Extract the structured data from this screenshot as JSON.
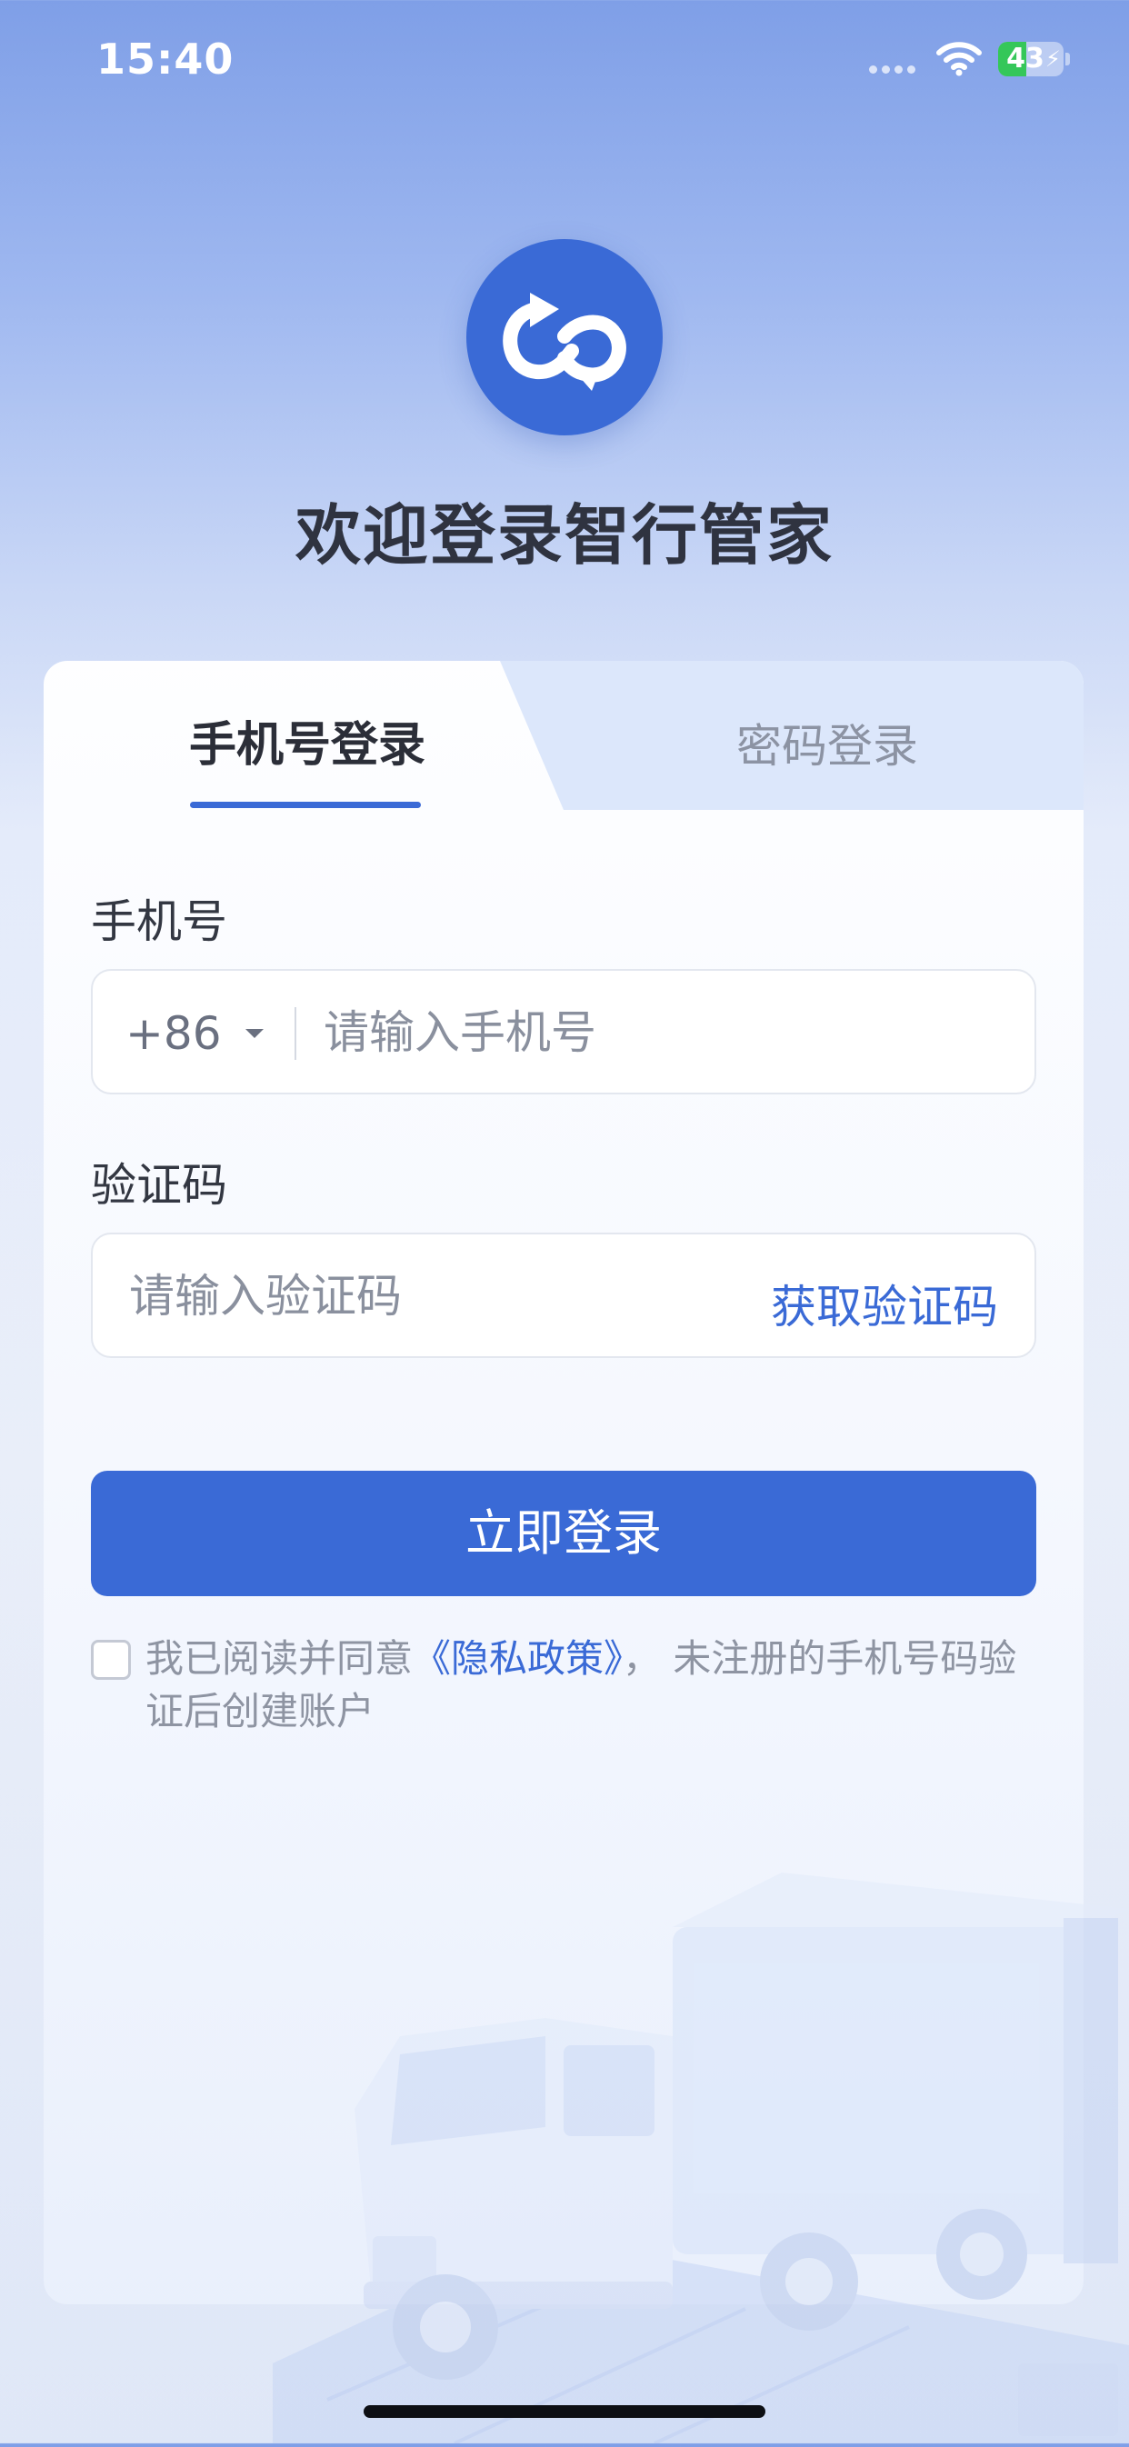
{
  "status_bar": {
    "time": "15:40",
    "battery_level": "43",
    "battery_fraction": 0.43,
    "wifi_icon": "wifi-icon",
    "battery_icon": "battery-charging-icon"
  },
  "header": {
    "logo_icon": "app-logo-infinity-arrow-icon",
    "welcome_title": "欢迎登录智行管家"
  },
  "tabs": [
    {
      "label": "手机号登录",
      "active": true
    },
    {
      "label": "密码登录",
      "active": false
    }
  ],
  "form": {
    "phone_label": "手机号",
    "country_code": "+86",
    "phone_placeholder": "请输入手机号",
    "phone_value": "",
    "code_label": "验证码",
    "code_placeholder": "请输入验证码",
    "code_value": "",
    "get_code_label": "获取验证码",
    "login_button": "立即登录",
    "agreement_checked": false,
    "agreement_prefix": "我已阅读并同意",
    "privacy_link": "《隐私政策》",
    "agreement_suffix": "，  未注册的手机号码验证后创建账户"
  },
  "colors": {
    "accent": "#3a6ad6",
    "title_text": "#2f3340",
    "muted_text": "#8e94a2"
  }
}
